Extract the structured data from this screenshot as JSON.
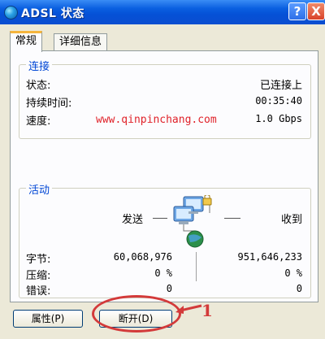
{
  "window": {
    "title": "ADSL 状态",
    "help_label": "?",
    "close_label": "X"
  },
  "tabs": [
    {
      "label": "常规",
      "active": true
    },
    {
      "label": "详细信息",
      "active": false
    }
  ],
  "connection": {
    "title": "连接",
    "rows": [
      {
        "label": "状态:",
        "value": "已连接上"
      },
      {
        "label": "持续时间:",
        "value": "00:35:40"
      },
      {
        "label": "速度:",
        "value": "1.0 Gbps"
      }
    ]
  },
  "watermark": "www.qinpinchang.com",
  "activity": {
    "title": "活动",
    "sent_label": "发送",
    "received_label": "收到",
    "rows": [
      {
        "label": "字节:",
        "sent": "60,068,976",
        "received": "951,646,233"
      },
      {
        "label": "压缩:",
        "sent": "0 %",
        "received": "0 %"
      },
      {
        "label": "错误:",
        "sent": "0",
        "received": "0"
      }
    ]
  },
  "buttons": {
    "properties": "属性(P)",
    "disconnect": "断开(D)"
  },
  "annotation": {
    "number": "1"
  },
  "colors": {
    "titlebar": "#0550d6",
    "group_title": "#0046d5",
    "annotation": "#d33a3a",
    "watermark": "#e0222a"
  }
}
